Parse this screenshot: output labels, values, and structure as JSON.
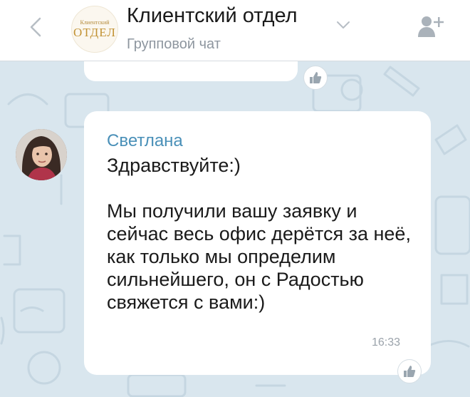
{
  "header": {
    "title": "Клиентский отдел",
    "subtitle": "Групповой чат",
    "logo_small": "Клиентский",
    "logo_big": "ОТДЕЛ"
  },
  "icons": {
    "back": "chevron-left-icon",
    "dropdown": "chevron-down-icon",
    "add_member": "add-user-icon",
    "like": "thumbs-up-icon"
  },
  "message": {
    "sender": "Светлана",
    "text": "Здравствуйте:)\n\nМы получили вашу заявку и сейчас весь офис дерётся за неё,\nкак только мы определим сильнейшего, он с Радостью свяжется с вами:)",
    "time": "16:33"
  },
  "colors": {
    "chat_background": "#d9e6ee",
    "sender_name": "#4a90b8",
    "header_background": "#ffffff"
  }
}
